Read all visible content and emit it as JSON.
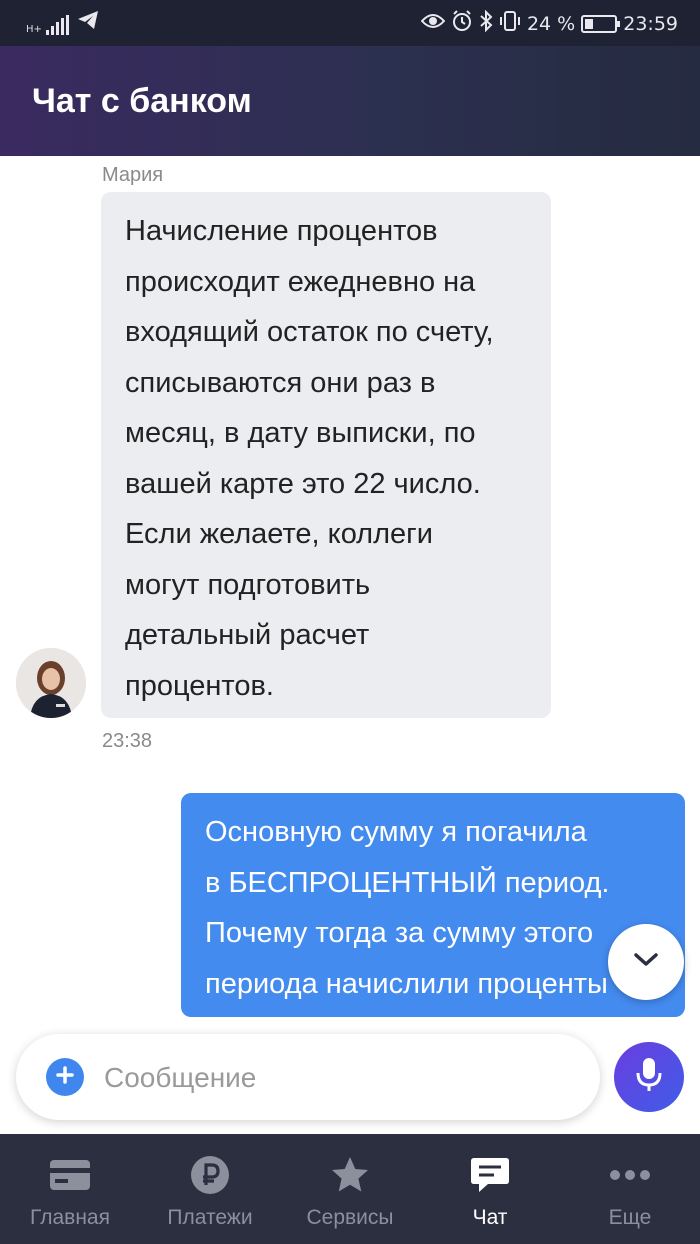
{
  "status_bar": {
    "network": "H+",
    "battery": "24 %",
    "time": "23:59"
  },
  "header": {
    "title": "Чат с банком"
  },
  "messages": {
    "incoming": {
      "sender": "Мария",
      "lines": [
        "Начисление процентов",
        "происходит ежедневно на",
        "входящий остаток по счету,",
        "списываются они раз в",
        "месяц, в дату выписки, по",
        "вашей карте это 22 число.",
        "Если желаете, коллеги",
        "могут подготовить",
        "детальный расчет",
        "процентов."
      ],
      "time": "23:38"
    },
    "outgoing": {
      "lines": [
        "Основную сумму я погачила",
        "в БЕСПРОЦЕНТНЫЙ период.",
        "Почему тогда за сумму этого",
        "периода начислили проценты"
      ]
    }
  },
  "composer": {
    "placeholder": "Сообщение"
  },
  "nav": {
    "items": [
      {
        "label": "Главная",
        "icon": "card-icon"
      },
      {
        "label": "Платежи",
        "icon": "ruble-icon"
      },
      {
        "label": "Сервисы",
        "icon": "star-icon"
      },
      {
        "label": "Чат",
        "icon": "chat-icon",
        "active": true
      },
      {
        "label": "Еще",
        "icon": "more-icon"
      }
    ]
  },
  "colors": {
    "accent": "#448bf0",
    "header_from": "#3a2a60",
    "nav_bg": "#2b2f3f"
  }
}
